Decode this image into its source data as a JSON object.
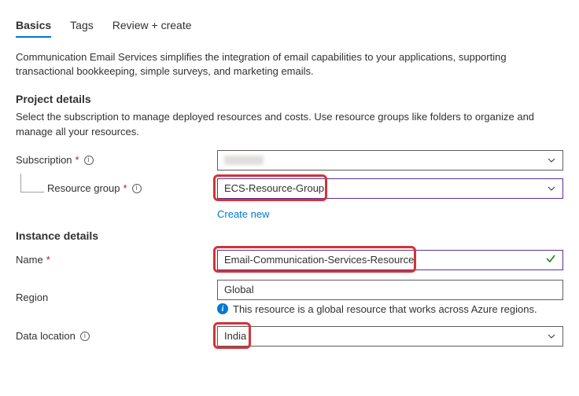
{
  "tabs": {
    "basics": "Basics",
    "tags": "Tags",
    "review": "Review + create"
  },
  "intro": "Communication Email Services simplifies the integration of email capabilities to your applications, supporting transactional bookkeeping, simple surveys, and marketing emails.",
  "project": {
    "heading": "Project details",
    "desc": "Select the subscription to manage deployed resources and costs. Use resource groups like folders to organize and manage all your resources.",
    "subscription_label": "Subscription",
    "resource_group_label": "Resource group",
    "resource_group_value": "ECS-Resource-Group",
    "create_new": "Create new"
  },
  "instance": {
    "heading": "Instance details",
    "name_label": "Name",
    "name_value": "Email-Communication-Services-Resource",
    "region_label": "Region",
    "region_value": "Global",
    "region_hint": "This resource is a global resource that works across Azure regions.",
    "data_location_label": "Data location",
    "data_location_value": "India"
  }
}
